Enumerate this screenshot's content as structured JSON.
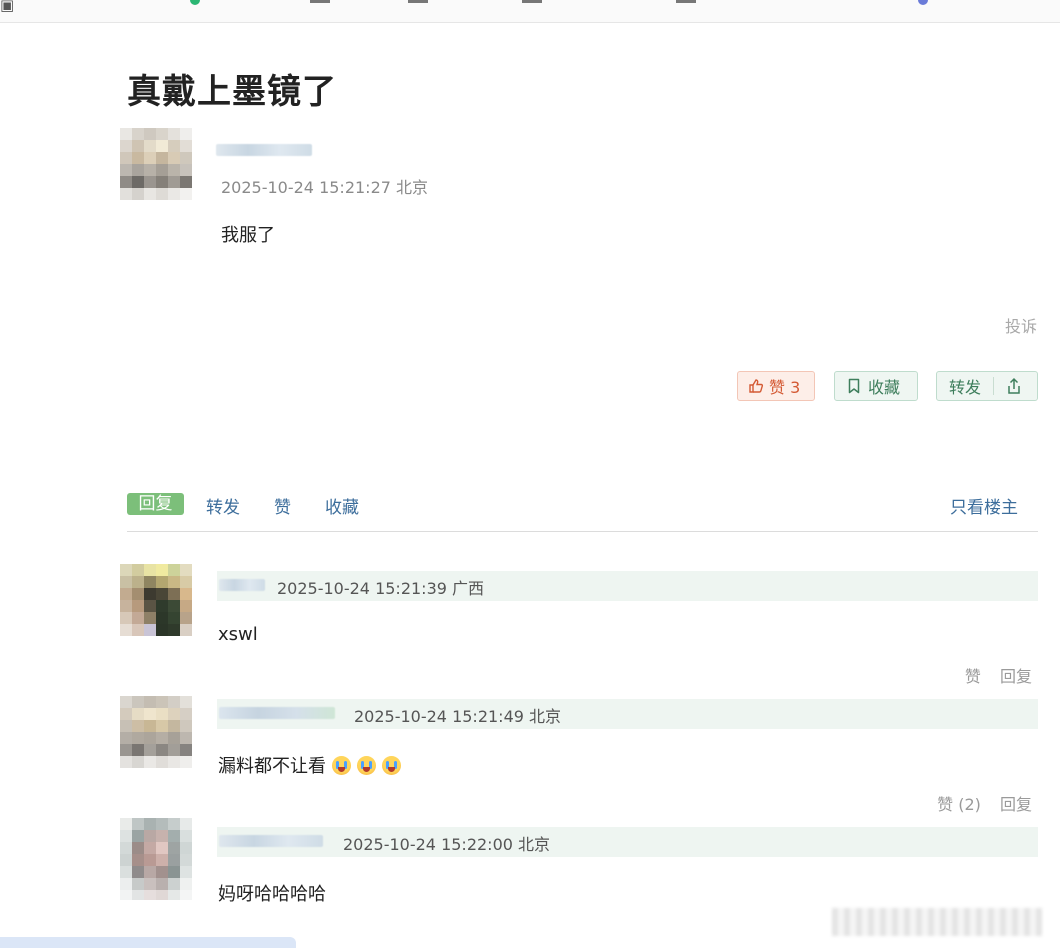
{
  "post": {
    "title": "真戴上墨镜了",
    "meta": "2025-10-24 15:21:27 北京",
    "body": "我服了",
    "report_label": "投诉",
    "like_label": "赞 3",
    "favorite_label": "收藏",
    "share_label": "转发"
  },
  "tabs": {
    "reply": "回复",
    "forward": "转发",
    "like": "赞",
    "favorite": "收藏",
    "only_op": "只看楼主"
  },
  "comments": [
    {
      "meta": "2025-10-24 15:21:39 广西",
      "text": "xswl",
      "like_label": "赞",
      "reply_label": "回复"
    },
    {
      "meta": "2025-10-24 15:21:49 北京",
      "text": "漏料都不让看",
      "emoji_count": 3,
      "like_label": "赞 (2)",
      "reply_label": "回复"
    },
    {
      "meta": "2025-10-24 15:22:00 北京",
      "text": "妈呀哈哈哈哈"
    }
  ],
  "colors": {
    "title": "#222222",
    "link": "#3d6e9c",
    "active_tab": "#7cbf7a",
    "like_accent": "#d45a34",
    "green_accent": "#3e7e5c"
  }
}
